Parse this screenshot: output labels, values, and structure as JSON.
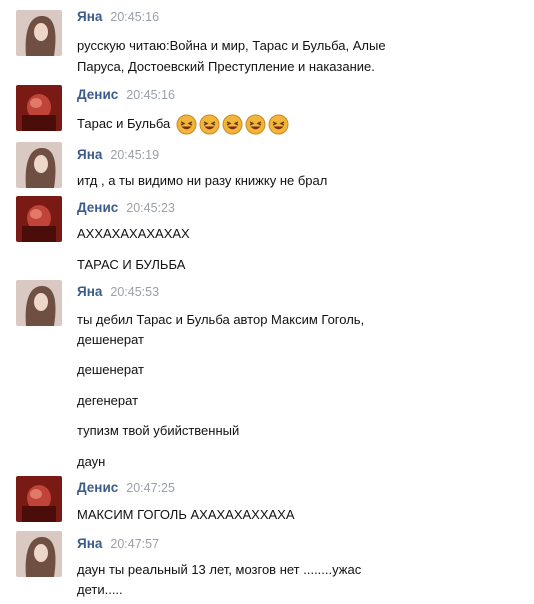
{
  "messages": [
    {
      "author": "Яна",
      "time": "20:45:16",
      "avatar": "yana-avatar",
      "lines": [
        "русскую читаю:Война и мир, Тарас и Бульба, Алые",
        "Паруса, Достоевский Преступление и наказание."
      ]
    },
    {
      "author": "Денис",
      "time": "20:45:16",
      "avatar": "denis-avatar",
      "lines": [
        "Тарас и Бульба"
      ],
      "emoji": "laughing-face-icon",
      "emoji_count": 5
    },
    {
      "author": "Яна",
      "time": "20:45:19",
      "avatar": "yana-avatar",
      "lines": [
        "итд , а ты видимо ни разу книжку не брал"
      ]
    },
    {
      "author": "Денис",
      "time": "20:45:23",
      "avatar": "denis-avatar",
      "lines": [
        "АХХАХАХАХАХАХ",
        "ТАРАС И БУЛЬБА"
      ]
    },
    {
      "author": "Яна",
      "time": "20:45:53",
      "avatar": "yana-avatar",
      "lines": [
        "ты дебил Тарас и Бульба автор Максим Гоголь,",
        "дешенерат",
        "дешенерат",
        "дегенерат",
        "тупизм твой убийственный",
        "даун"
      ]
    },
    {
      "author": "Денис",
      "time": "20:47:25",
      "avatar": "denis-avatar",
      "lines": [
        "МАКСИМ ГОГОЛЬ АХАХАХАХХАХА"
      ]
    },
    {
      "author": "Яна",
      "time": "20:47:57",
      "avatar": "yana-avatar",
      "lines": [
        "даун ты реальный 13 лет, мозгов нет ........ужас",
        "дети....."
      ]
    }
  ],
  "colors": {
    "author": "#3b5b8a",
    "time": "#9aa0a8",
    "emoji": "#f2b53a"
  }
}
